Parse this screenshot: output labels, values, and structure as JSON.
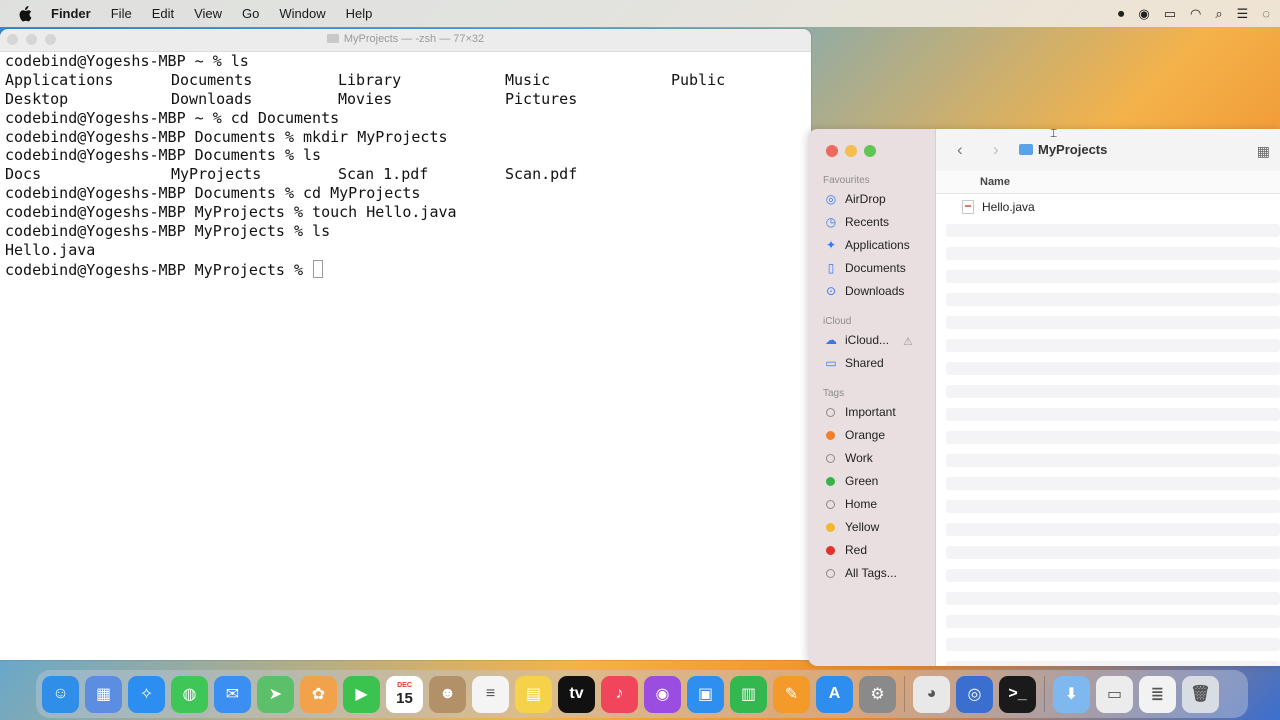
{
  "menubar": {
    "app_name": "Finder",
    "items": [
      "File",
      "Edit",
      "View",
      "Go",
      "Window",
      "Help"
    ],
    "status_icons": [
      "record-icon",
      "user-icon",
      "battery-icon",
      "wifi-icon",
      "search-icon",
      "control-center-icon",
      "siri-icon"
    ]
  },
  "terminal": {
    "title": "MyProjects — -zsh — 77×32",
    "lines": [
      {
        "type": "text",
        "text": "codebind@Yogeshs-MBP ~ % ls"
      },
      {
        "type": "cols",
        "cols": [
          "Applications",
          "Documents",
          "Library",
          "Music",
          "Public"
        ]
      },
      {
        "type": "cols",
        "cols": [
          "Desktop",
          "Downloads",
          "Movies",
          "Pictures",
          ""
        ]
      },
      {
        "type": "text",
        "text": "codebind@Yogeshs-MBP ~ % cd Documents"
      },
      {
        "type": "text",
        "text": "codebind@Yogeshs-MBP Documents % mkdir MyProjects"
      },
      {
        "type": "text",
        "text": "codebind@Yogeshs-MBP Documents % ls"
      },
      {
        "type": "cols",
        "cols": [
          "Docs",
          "MyProjects",
          "Scan 1.pdf",
          "Scan.pdf",
          ""
        ]
      },
      {
        "type": "text",
        "text": "codebind@Yogeshs-MBP Documents % cd MyProjects"
      },
      {
        "type": "text",
        "text": "codebind@Yogeshs-MBP MyProjects % touch Hello.java"
      },
      {
        "type": "text",
        "text": "codebind@Yogeshs-MBP MyProjects % ls"
      },
      {
        "type": "text",
        "text": "Hello.java"
      }
    ],
    "prompt": "codebind@Yogeshs-MBP MyProjects % "
  },
  "finder": {
    "path_title": "MyProjects",
    "column_name": "Name",
    "sections": {
      "favourites": "Favourites",
      "icloud": "iCloud",
      "tags": "Tags"
    },
    "favourites": [
      {
        "label": "AirDrop",
        "icon": "airdrop-icon",
        "glyph": "◎"
      },
      {
        "label": "Recents",
        "icon": "clock-icon",
        "glyph": "◷"
      },
      {
        "label": "Applications",
        "icon": "applications-icon",
        "glyph": "✦"
      },
      {
        "label": "Documents",
        "icon": "document-icon",
        "glyph": "▯"
      },
      {
        "label": "Downloads",
        "icon": "download-icon",
        "glyph": "⊙"
      }
    ],
    "icloud_items": [
      {
        "label": "iCloud...",
        "icon": "cloud-icon",
        "glyph": "☁"
      },
      {
        "label": "Shared",
        "icon": "shared-folder-icon",
        "glyph": "▭"
      }
    ],
    "tags": [
      {
        "label": "Important",
        "color": ""
      },
      {
        "label": "Orange",
        "color": "#f0802a"
      },
      {
        "label": "Work",
        "color": ""
      },
      {
        "label": "Green",
        "color": "#38b24a"
      },
      {
        "label": "Home",
        "color": ""
      },
      {
        "label": "Yellow",
        "color": "#f2b82a"
      },
      {
        "label": "Red",
        "color": "#e0312b"
      },
      {
        "label": "All Tags...",
        "color": ""
      }
    ],
    "files": [
      "Hello.java"
    ]
  },
  "dock": {
    "apps": [
      {
        "name": "finder",
        "glyph": "☺",
        "color": "#2f8fe8"
      },
      {
        "name": "launchpad",
        "glyph": "▦",
        "color": "#5b8de0"
      },
      {
        "name": "safari",
        "glyph": "✧",
        "color": "#2c8ef0"
      },
      {
        "name": "messages",
        "glyph": "◍",
        "color": "#3ec657"
      },
      {
        "name": "mail",
        "glyph": "✉",
        "color": "#3b8ef2"
      },
      {
        "name": "maps",
        "glyph": "➤",
        "color": "#5cbf6a"
      },
      {
        "name": "photos",
        "glyph": "✿",
        "color": "#f2a24a"
      },
      {
        "name": "facetime",
        "glyph": "▶",
        "color": "#3bc34f"
      },
      {
        "name": "calendar",
        "glyph": "15",
        "color": "#ffffff",
        "month": "DEC"
      },
      {
        "name": "contacts",
        "glyph": "☻",
        "color": "#b39168"
      },
      {
        "name": "reminders",
        "glyph": "≡",
        "color": "#f4f4f4"
      },
      {
        "name": "notes",
        "glyph": "▤",
        "color": "#f6d24a"
      },
      {
        "name": "tv",
        "glyph": "tv",
        "color": "#111111"
      },
      {
        "name": "music",
        "glyph": "♪",
        "color": "#f0455a"
      },
      {
        "name": "podcasts",
        "glyph": "◉",
        "color": "#9a4de0"
      },
      {
        "name": "keynote",
        "glyph": "▣",
        "color": "#2f8ff0"
      },
      {
        "name": "numbers",
        "glyph": "▥",
        "color": "#33b84f"
      },
      {
        "name": "pages",
        "glyph": "✎",
        "color": "#f39a2a"
      },
      {
        "name": "app-store",
        "glyph": "A",
        "color": "#2d8ef0"
      },
      {
        "name": "system-settings",
        "glyph": "⚙",
        "color": "#8a8a8a"
      },
      {
        "name": "chrome",
        "glyph": "◕",
        "color": "#e8e8e8"
      },
      {
        "name": "quicktime",
        "glyph": "◎",
        "color": "#3a6fd0"
      },
      {
        "name": "terminal",
        "glyph": ">_",
        "color": "#1a1a1a"
      },
      {
        "name": "downloads-stack",
        "glyph": "⬇",
        "color": "#7fb8ee"
      },
      {
        "name": "recent-window",
        "glyph": "▭",
        "color": "#ececec"
      },
      {
        "name": "recent-document",
        "glyph": "≣",
        "color": "#f2f2f2"
      },
      {
        "name": "trash",
        "glyph": "🗑",
        "color": "#d8dde4"
      }
    ]
  }
}
